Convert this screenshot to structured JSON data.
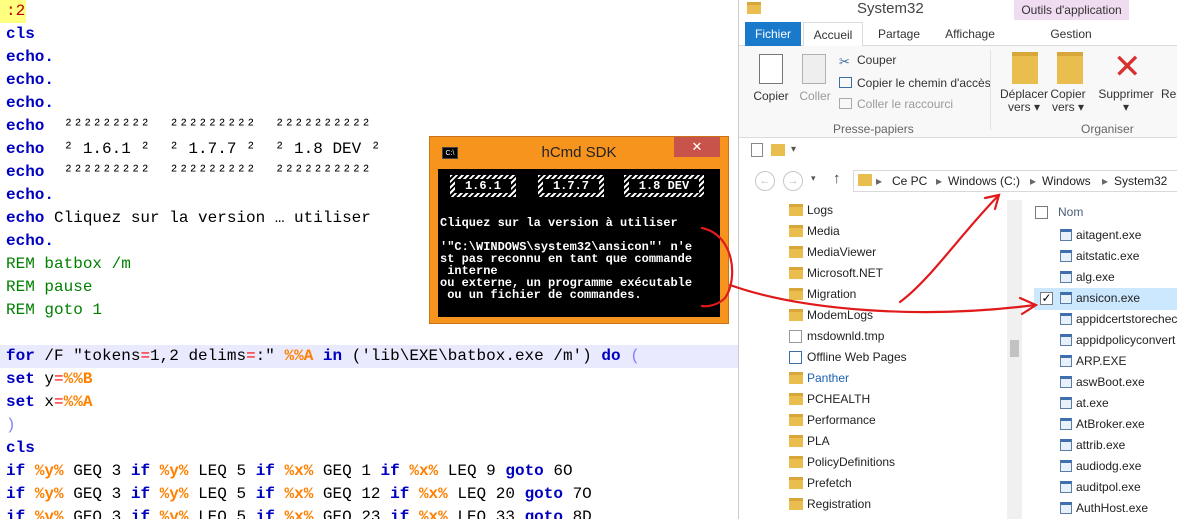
{
  "editor": {
    "lines": [
      ":2",
      "cls",
      "echo.",
      "echo.",
      "echo.",
      "echo  ²²²²²²²²²  ²²²²²²²²²  ²²²²²²²²²²",
      "echo  ² 1.6.1 ²  ² 1.7.7 ²  ² 1.8 DEV ²",
      "echo  ²²²²²²²²²  ²²²²²²²²²  ²²²²²²²²²²",
      "echo.",
      "echo Cliquez sur la version … utiliser",
      "echo.",
      "REM batbox /m",
      "REM pause",
      "REM goto 1",
      "",
      "for /F \"tokens=1,2 delims=:\" %%A in ('lib\\EXE\\batbox.exe /m') do (",
      "set y=%%B",
      "set x=%%A",
      ")",
      "cls",
      "if %y% GEQ 3 if %y% LEQ 5 if %x% GEQ 1 if %x% LEQ 9 goto 6O",
      "if %y% GEQ 3 if %y% LEQ 5 if %x% GEQ 12 if %x% LEQ 20 goto 7O",
      "if %y% GEQ 3 if %y% LEQ 5 if %x% GEQ 23 if %x% LEQ 33 goto 8D"
    ],
    "tokens": {
      "label": ":2",
      "echo_lines": {
        "r5a": "²²²²²²²²²  ²²²²²²²²²  ²²²²²²²²²²",
        "r6a": "² 1.6.1 ²  ² 1.7.7 ²  ² 1.8 DEV ²",
        "r7a": "²²²²²²²²²  ²²²²²²²²²  ²²²²²²²²²²",
        "r9a": "Cliquez sur la version … utiliser"
      },
      "rem1": "REM batbox /m",
      "rem2": "REM pause",
      "rem3": "REM goto 1",
      "for_str": "\"tokens",
      "for_eq1": "=",
      "for_mid": "1,2 delims",
      "for_eq2": "=",
      "for_end": ":\"",
      "for_var": "%%A",
      "for_path": "('lib\\EXE\\batbox.exe /m')",
      "paren_open": "(",
      "paren_close": ")",
      "set_y": "y",
      "set_x": "x",
      "set_eq": "=",
      "var_b": "%%B",
      "var_a": "%%A",
      "vy": "%y%",
      "vx": "%x%"
    }
  },
  "hcmd": {
    "title": "hCmd SDK",
    "close": "✕",
    "sys_icon": "C:\\",
    "versions": [
      "1.6.1",
      "1.7.7",
      "1.8 DEV"
    ],
    "console_lines": [
      "Cliquez sur la version à utiliser",
      "",
      "'\"C:\\WINDOWS\\system32\\ansicon\"' n'e",
      "st pas reconnu en tant que commande",
      " interne",
      "ou externe, un programme exécutable",
      " ou un fichier de commandes."
    ]
  },
  "explorer": {
    "title": "System32",
    "context_tab": "Outils d'application",
    "tabs": [
      "Fichier",
      "Accueil",
      "Partage",
      "Affichage",
      "Gestion"
    ],
    "ribbon": {
      "copier": "Copier",
      "coller": "Coller",
      "couper": "Couper",
      "copier_chemin": "Copier le chemin d'accès",
      "coller_raccourci": "Coller le raccourci",
      "group1": "Presse-papiers",
      "deplacer": "Déplacer vers ▾",
      "copier_vers": "Copier vers ▾",
      "supprimer": "Supprimer ▾",
      "renommer": "Ren",
      "group2": "Organiser"
    },
    "breadcrumb": [
      "Ce PC",
      "Windows (C:)",
      "Windows",
      "System32"
    ],
    "folders": [
      "Logs",
      "Media",
      "MediaViewer",
      "Microsoft.NET",
      "Migration",
      "ModemLogs",
      "msdownld.tmp",
      "Offline Web Pages",
      "Panther",
      "PCHEALTH",
      "Performance",
      "PLA",
      "PolicyDefinitions",
      "Prefetch",
      "Registration"
    ],
    "column_header": "Nom",
    "files": [
      "aitagent.exe",
      "aitstatic.exe",
      "alg.exe",
      "ansicon.exe",
      "appidcertstorechec",
      "appidpolicyconvert",
      "ARP.EXE",
      "aswBoot.exe",
      "at.exe",
      "AtBroker.exe",
      "attrib.exe",
      "audiodg.exe",
      "auditpol.exe",
      "AuthHost.exe"
    ],
    "selected_file": "ansicon.exe"
  },
  "colors": {
    "keyword": "#0000c0",
    "rem": "#008000",
    "variable": "#ff8000",
    "operator": "#ff0000",
    "hcmd_frame": "#f7941d",
    "ribbon_tab": "#1979ca",
    "arrow": "#e0191b"
  }
}
